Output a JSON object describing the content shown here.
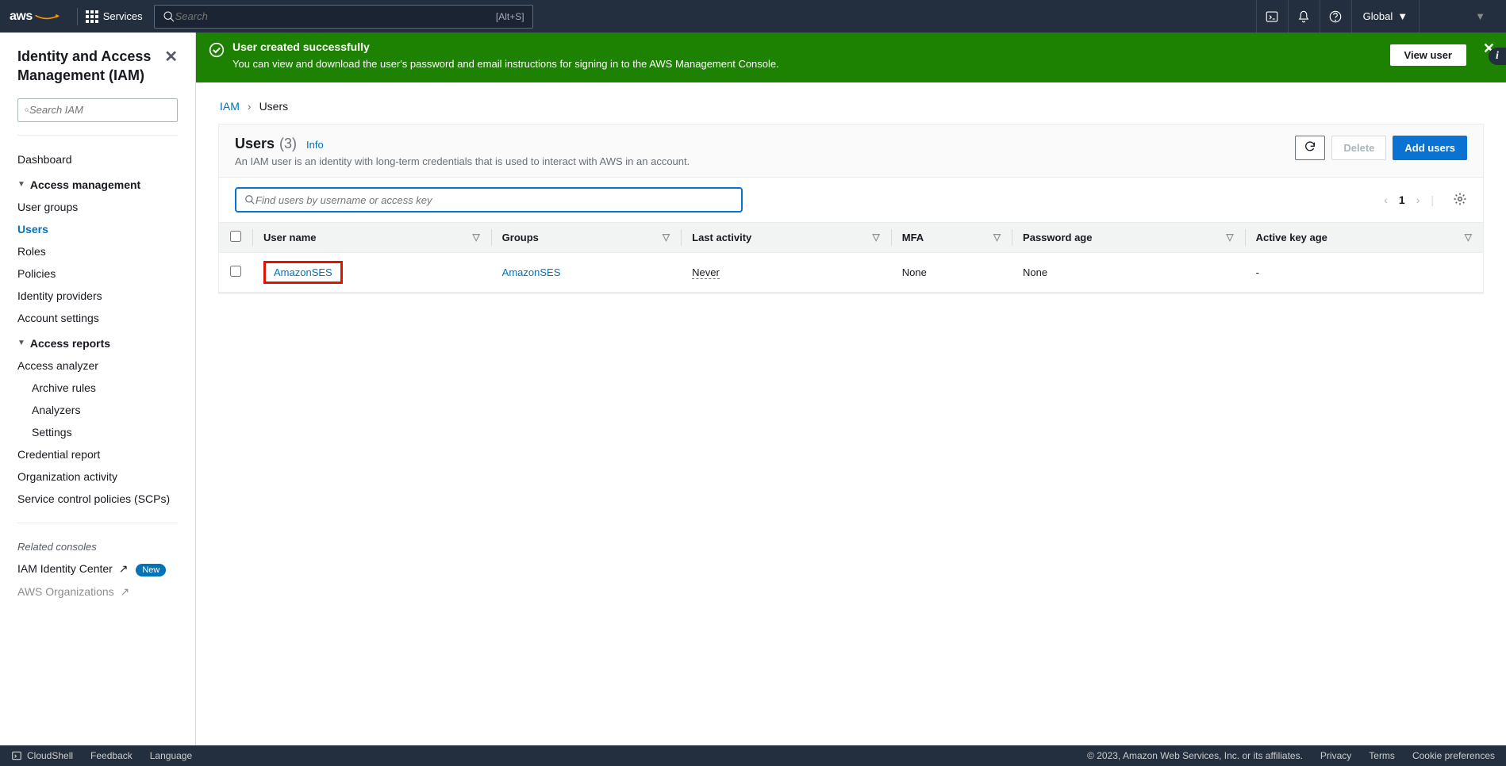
{
  "topnav": {
    "logo_text": "aws",
    "services_label": "Services",
    "search_placeholder": "Search",
    "search_shortcut": "[Alt+S]",
    "region": "Global",
    "account": ""
  },
  "sidebar": {
    "title": "Identity and Access Management (IAM)",
    "search_placeholder": "Search IAM",
    "dashboard": "Dashboard",
    "section_access_mgmt": "Access management",
    "access_mgmt_items": {
      "user_groups": "User groups",
      "users": "Users",
      "roles": "Roles",
      "policies": "Policies",
      "identity_providers": "Identity providers",
      "account_settings": "Account settings"
    },
    "section_access_reports": "Access reports",
    "access_reports_items": {
      "access_analyzer": "Access analyzer",
      "archive_rules": "Archive rules",
      "analyzers": "Analyzers",
      "settings": "Settings",
      "credential_report": "Credential report",
      "organization_activity": "Organization activity",
      "scps": "Service control policies (SCPs)"
    },
    "related_consoles": "Related consoles",
    "iam_identity_center": "IAM Identity Center",
    "aws_organizations": "AWS Organizations",
    "new_badge": "New"
  },
  "banner": {
    "title": "User created successfully",
    "message": "You can view and download the user's password and email instructions for signing in to the AWS Management Console.",
    "view_button": "View user"
  },
  "breadcrumbs": {
    "root": "IAM",
    "current": "Users"
  },
  "panel": {
    "title": "Users",
    "count": "(3)",
    "info": "Info",
    "subtitle": "An IAM user is an identity with long-term credentials that is used to interact with AWS in an account.",
    "refresh_label": "",
    "delete_label": "Delete",
    "add_label": "Add users",
    "find_placeholder": "Find users by username or access key",
    "page_number": "1"
  },
  "table": {
    "columns": {
      "username": "User name",
      "groups": "Groups",
      "last_activity": "Last activity",
      "mfa": "MFA",
      "password_age": "Password age",
      "active_key_age": "Active key age"
    },
    "rows": [
      {
        "username": "AmazonSES",
        "groups": "AmazonSES",
        "last_activity": "Never",
        "mfa": "None",
        "password_age": "None",
        "active_key_age": "-"
      }
    ]
  },
  "footer": {
    "cloudshell": "CloudShell",
    "feedback": "Feedback",
    "language": "Language",
    "copyright": "© 2023, Amazon Web Services, Inc. or its affiliates.",
    "privacy": "Privacy",
    "terms": "Terms",
    "cookie": "Cookie preferences"
  }
}
